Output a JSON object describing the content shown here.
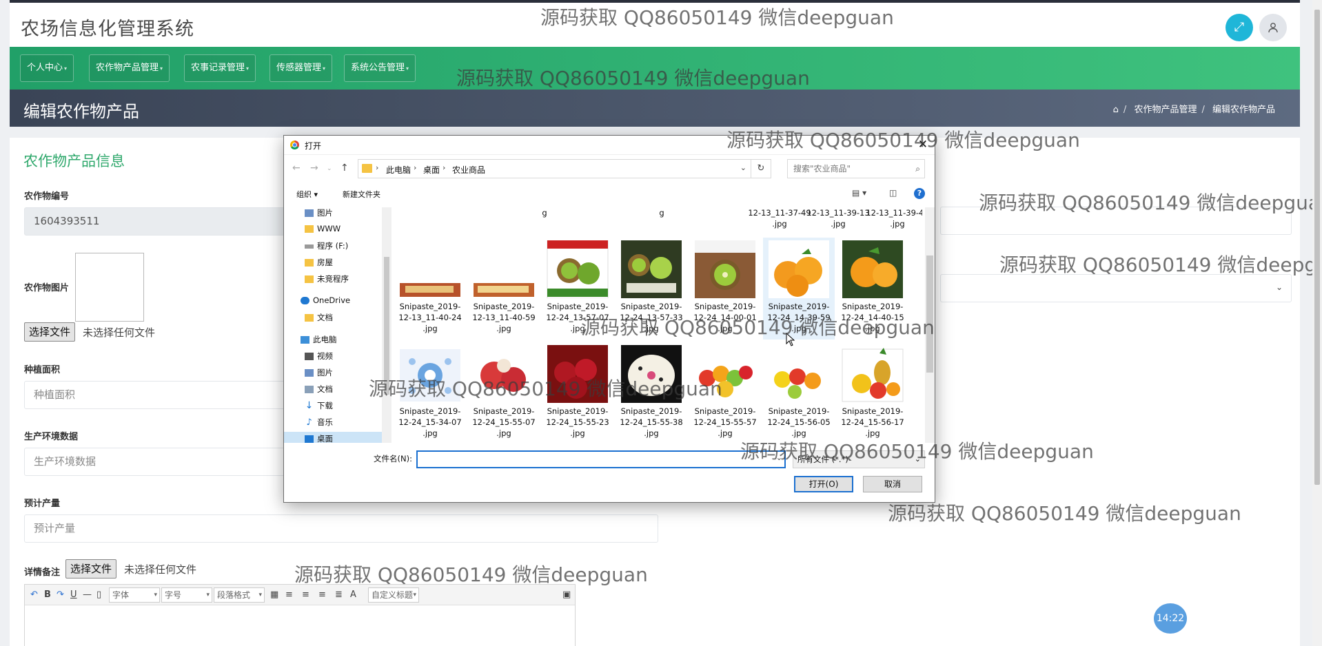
{
  "app": {
    "title": "农场信息化管理系统"
  },
  "nav": {
    "items": [
      {
        "label": "个人中心"
      },
      {
        "label": "农作物产品管理"
      },
      {
        "label": "农事记录管理"
      },
      {
        "label": "传感器管理"
      },
      {
        "label": "系统公告管理"
      }
    ]
  },
  "page": {
    "title": "编辑农作物产品",
    "breadcrumb": [
      "农作物产品管理",
      "编辑农作物产品"
    ]
  },
  "form": {
    "section_title": "农作物产品信息",
    "crop_no_label": "农作物编号",
    "crop_no_value": "1604393511",
    "crop_image_label": "农作物图片",
    "choose_file": "选择文件",
    "no_file": "未选择任何文件",
    "area_label": "种植面积",
    "area_placeholder": "种植面积",
    "env_label": "生产环境数据",
    "env_placeholder": "生产环境数据",
    "yield_label": "预计产量",
    "yield_placeholder": "预计产量",
    "detail_label": "详情备注"
  },
  "editor": {
    "font": "字体",
    "size": "字号",
    "paragraph": "段落格式",
    "custom_title": "自定义标题"
  },
  "dialog": {
    "title": "打开",
    "path": [
      "此电脑",
      "桌面",
      "农业商品"
    ],
    "search_placeholder": "搜索\"农业商品\"",
    "organize": "组织",
    "new_folder": "新建文件夹",
    "tree": [
      "图片",
      "WWW",
      "程序 (F:)",
      "房屋",
      "未竞程序",
      "OneDrive",
      "文档",
      "此电脑",
      "视频",
      "图片",
      "文档",
      "下载",
      "音乐",
      "桌面"
    ],
    "top_row": [
      "g",
      "g",
      "12-13_11-37-49\n.jpg",
      "12-13_11-39-13\n.jpg",
      "12-13_11-39-43\n.jpg"
    ],
    "row2": [
      "Snipaste_2019-\n12-13_11-40-24\n.jpg",
      "Snipaste_2019-\n12-13_11-40-59\n.jpg",
      "Snipaste_2019-\n12-24_13-57-07\n.jpg",
      "Snipaste_2019-\n12-24_13-57-33\n.jpg",
      "Snipaste_2019-\n12-24_14-00-01\n.jpg",
      "Snipaste_2019-\n12-24_14-39-59\n.jpg",
      "Snipaste_2019-\n12-24_14-40-15\n.jpg"
    ],
    "row3": [
      "Snipaste_2019-\n12-24_15-34-07\n.jpg",
      "Snipaste_2019-\n12-24_15-55-07\n.jpg",
      "Snipaste_2019-\n12-24_15-55-23\n.jpg",
      "Snipaste_2019-\n12-24_15-55-38\n.jpg",
      "Snipaste_2019-\n12-24_15-55-57\n.jpg",
      "Snipaste_2019-\n12-24_15-56-05\n.jpg",
      "Snipaste_2019-\n12-24_15-56-17\n.jpg"
    ],
    "filename_label": "文件名(N):",
    "filetype": "所有文件 (*.*)",
    "open": "打开(O)",
    "cancel": "取消"
  },
  "watermark": "源码获取 QQ86050149 微信deepguan",
  "clock": "14:22"
}
